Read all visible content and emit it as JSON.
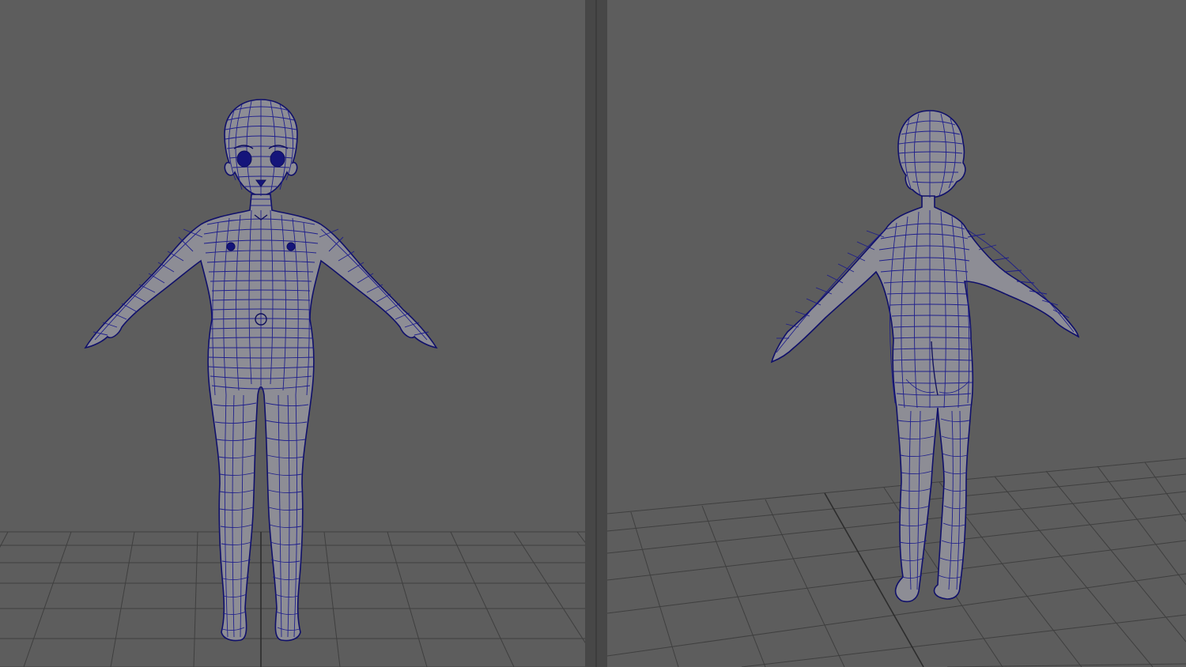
{
  "viewports": [
    {
      "id": "front",
      "view": "front-orthographic",
      "content": "character-mesh-front"
    },
    {
      "id": "persp",
      "view": "perspective",
      "content": "character-mesh-back"
    }
  ],
  "colors": {
    "background": "#5d5d5d",
    "divider": "#474747",
    "grid_line": "#3f3f3f",
    "grid_axis": "#2d2d2d",
    "mesh_fill": "#8d8d95",
    "wireframe": "#1a1a8c"
  },
  "display": {
    "shading": "wireframe-on-shaded",
    "grid": true
  }
}
